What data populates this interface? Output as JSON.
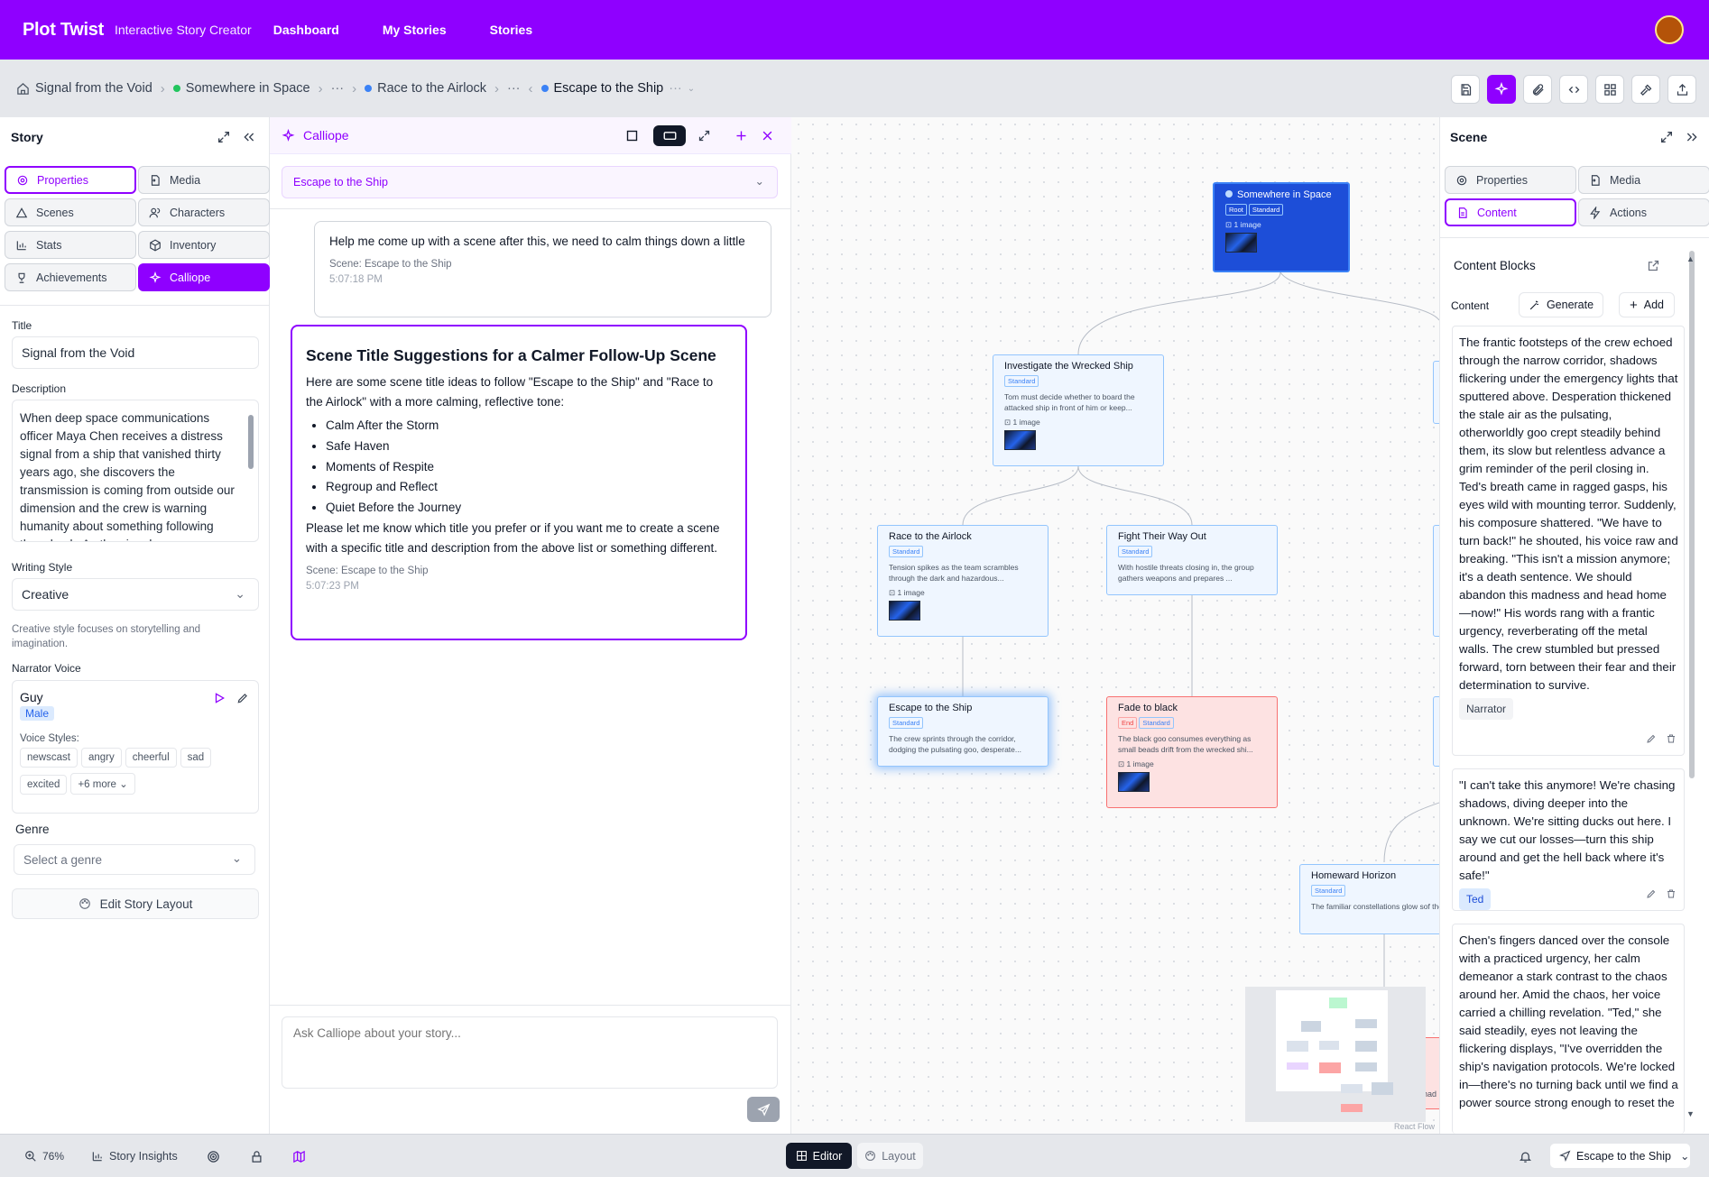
{
  "app": {
    "name": "Plot Twist",
    "tagline": "Interactive Story Creator",
    "nav": [
      "Dashboard",
      "My Stories",
      "Stories"
    ]
  },
  "breadcrumb": {
    "story": "Signal from the Void",
    "items": [
      "Somewhere in Space",
      "Race to the Airlock",
      "Escape to the Ship"
    ],
    "ellipsis": "···"
  },
  "story_panel": {
    "title": "Story",
    "tabs": [
      "Properties",
      "Media",
      "Scenes",
      "Characters",
      "Stats",
      "Inventory",
      "Achievements",
      "Calliope"
    ],
    "title_label": "Title",
    "title_value": "Signal from the Void",
    "description_label": "Description",
    "description_value": "When deep space communications officer Maya Chen receives a distress signal from a ship that vanished thirty years ago, she discovers the transmission is coming from outside our dimension and the crew is warning humanity about something following them back. As the signal grows",
    "writing_style_label": "Writing Style",
    "writing_style_value": "Creative",
    "writing_style_help": "Creative style focuses on storytelling and imagination.",
    "narrator_label": "Narrator Voice",
    "narrator_name": "Guy",
    "narrator_gender": "Male",
    "voice_styles_label": "Voice Styles:",
    "voice_styles": [
      "newscast",
      "angry",
      "cheerful",
      "sad",
      "excited"
    ],
    "voice_more": "+6 more",
    "genre_label": "Genre",
    "genre_placeholder": "Select a genre",
    "edit_layout": "Edit Story Layout"
  },
  "calliope": {
    "title": "Calliope",
    "scene_select": "Escape to the Ship",
    "user_message": "Help me come up with a scene after this, we need to calm things down a little",
    "user_scene": "Scene: Escape to the Ship",
    "user_time": "5:07:18 PM",
    "reply_title": "Scene Title Suggestions for a Calmer Follow-Up Scene",
    "reply_intro": "Here are some scene title ideas to follow \"Escape to the Ship\" and \"Race to the Airlock\" with a more calming, reflective tone:",
    "reply_list": [
      "Calm After the Storm",
      "Safe Haven",
      "Moments of Respite",
      "Regroup and Reflect",
      "Quiet Before the Journey"
    ],
    "reply_outro": "Please let me know which title you prefer or if you want me to create a scene with a specific title and description from the above list or something different.",
    "reply_scene": "Scene: Escape to the Ship",
    "reply_time": "5:07:23 PM",
    "input_placeholder": "Ask Calliope about your story..."
  },
  "graph": {
    "nodes": [
      {
        "id": "root",
        "title": "Somewhere in Space",
        "tags": [
          "Root",
          "Standard"
        ],
        "images": "1 image"
      },
      {
        "id": "investigate",
        "title": "Investigate the Wrecked Ship",
        "tags": [
          "Standard"
        ],
        "desc": "Tom must decide whether to board the attacked ship in front of him or keep...",
        "images": "1 image"
      },
      {
        "id": "race",
        "title": "Race to the Airlock",
        "tags": [
          "Standard"
        ],
        "desc": "Tension spikes as the team scrambles through the dark and hazardous...",
        "images": "1 image"
      },
      {
        "id": "fight",
        "title": "Fight Their Way Out",
        "tags": [
          "Standard"
        ],
        "desc": "With hostile threats closing in, the group gathers weapons and prepares ..."
      },
      {
        "id": "escape",
        "title": "Escape to the Ship",
        "tags": [
          "Standard"
        ],
        "desc": "The crew sprints through the corridor, dodging the pulsating goo, desperate..."
      },
      {
        "id": "fade",
        "title": "Fade to black",
        "tags": [
          "End",
          "Standard"
        ],
        "desc": "The black goo consumes everything as small beads drift from the wrecked shi...",
        "images": "1 image"
      },
      {
        "id": "homeward",
        "title": "Homeward Horizon",
        "tags": [
          "Standard"
        ],
        "desc": "The familiar constellations glow sof the distance, a guiding beacon pull"
      }
    ],
    "minimap_label": "React Flow",
    "partial_text": "had"
  },
  "scene_panel": {
    "title": "Scene",
    "tabs": [
      "Properties",
      "Media",
      "Content",
      "Actions"
    ],
    "section": "Content Blocks",
    "content_label": "Content",
    "generate": "Generate",
    "add": "Add",
    "blocks": [
      {
        "text": "The frantic footsteps of the crew echoed through the narrow corridor, shadows flickering under the emergency lights that sputtered above. Desperation thickened the stale air as the pulsating, otherworldly goo crept steadily behind them, its slow but relentless advance a grim reminder of the peril closing in. Ted's breath came in ragged gasps, his eyes wild with mounting terror. Suddenly, his composure shattered. \"We have to turn back!\" he shouted, his voice raw and breaking. \"This isn't a mission anymore; it's a death sentence. We should abandon this madness and head home—now!\" His words rang with a frantic urgency, reverberating off the metal walls. The crew stumbled but pressed forward, torn between their fear and their determination to survive.",
        "speaker": "Narrator"
      },
      {
        "text": "\"I can't take this anymore! We're chasing shadows, diving deeper into the unknown. We're sitting ducks out here. I say we cut our losses—turn this ship around and get the hell back where it's safe!\"",
        "speaker": "Ted"
      },
      {
        "text": "Chen's fingers danced over the console with a practiced urgency, her calm demeanor a stark contrast to the chaos around her. Amid the chaos, her voice carried a chilling revelation. \"Ted,\" she said steadily, eyes not leaving the flickering displays, \"I've overridden the ship's navigation protocols. We're locked in—there's no turning back until we find a power source strong enough to reset the"
      }
    ]
  },
  "statusbar": {
    "zoom": "76%",
    "insights": "Story Insights",
    "editor": "Editor",
    "layout": "Layout",
    "current_scene": "Escape to the Ship"
  },
  "colors": {
    "brand": "#8f00ff",
    "node_fill": "#eff6ff",
    "node_border": "#93c5fd",
    "root_node": "#1d4ed8",
    "end_node": "#fde2e2",
    "end_border": "#f87171"
  }
}
